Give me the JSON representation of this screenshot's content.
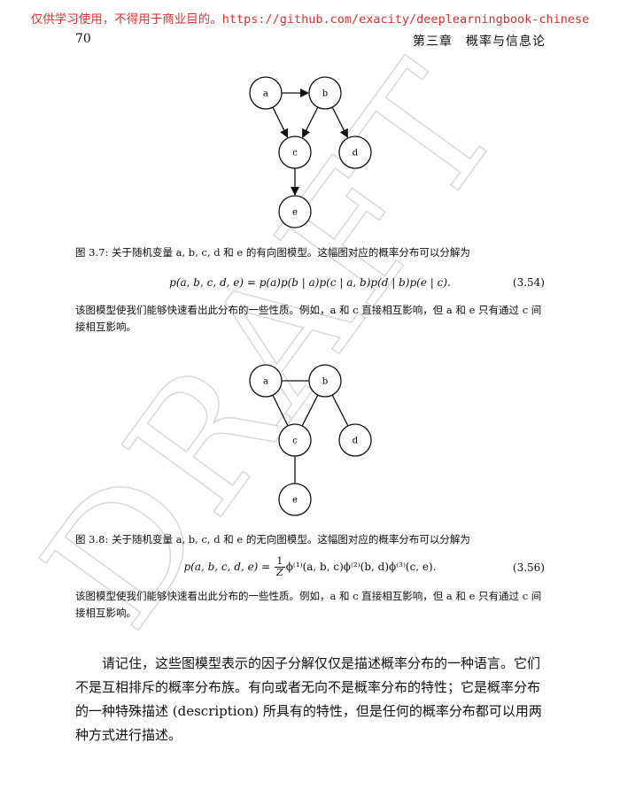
{
  "header": {
    "watermark_text": "仅供学习使用，不得用于商业目的。https://github.com/exacity/deeplearningbook-chinese",
    "page_number": "70",
    "chapter_title": "第三章　概率与信息论"
  },
  "draft_text": "DRAFT",
  "figure_directed": {
    "nodes": [
      {
        "id": "a",
        "label": "a"
      },
      {
        "id": "b",
        "label": "b"
      },
      {
        "id": "c",
        "label": "c"
      },
      {
        "id": "d",
        "label": "d"
      },
      {
        "id": "e",
        "label": "e"
      }
    ],
    "edges": [
      [
        "a",
        "b"
      ],
      [
        "a",
        "c"
      ],
      [
        "b",
        "c"
      ],
      [
        "b",
        "d"
      ],
      [
        "c",
        "e"
      ]
    ],
    "directed": true
  },
  "caption_directed": "图 3.7: 关于随机变量 a, b, c, d 和 e 的有向图模型。这幅图对应的概率分布可以分解为",
  "equation_354": {
    "text": "p(a, b, c, d, e) = p(a)p(b | a)p(c | a, b)p(d | b)p(e | c).",
    "number": "(3.54)"
  },
  "paragraph_directed": "该图模型使我们能够快速看出此分布的一些性质。例如，a 和 c 直接相互影响，但 a 和 e 只有通过 c 间接相互影响。",
  "figure_undirected": {
    "nodes": [
      {
        "id": "a",
        "label": "a"
      },
      {
        "id": "b",
        "label": "b"
      },
      {
        "id": "c",
        "label": "c"
      },
      {
        "id": "d",
        "label": "d"
      },
      {
        "id": "e",
        "label": "e"
      }
    ],
    "edges": [
      [
        "a",
        "b"
      ],
      [
        "a",
        "c"
      ],
      [
        "b",
        "c"
      ],
      [
        "b",
        "d"
      ],
      [
        "c",
        "e"
      ]
    ],
    "directed": false
  },
  "caption_undirected": "图 3.8: 关于随机变量 a, b, c, d 和 e 的无向图模型。这幅图对应的概率分布可以分解为",
  "equation_356": {
    "lhs": "p(a, b, c, d, e) = ",
    "frac_num": "1",
    "frac_den": "Z",
    "rhs": "ϕ⁽¹⁾(a, b, c)ϕ⁽²⁾(b, d)ϕ⁽³⁾(c, e).",
    "number": "(3.56)"
  },
  "paragraph_undirected": "该图模型使我们能够快速看出此分布的一些性质。例如，a 和 c 直接相互影响，但 a 和 e 只有通过 c 间接相互影响。",
  "body_paragraph": "请记住，这些图模型表示的因子分解仅仅是描述概率分布的一种语言。它们不是互相排斥的概率分布族。有向或者无向不是概率分布的特性；它是概率分布的一种特殊描述 (description) 所具有的特性，但是任何的概率分布都可以用两种方式进行描述。"
}
